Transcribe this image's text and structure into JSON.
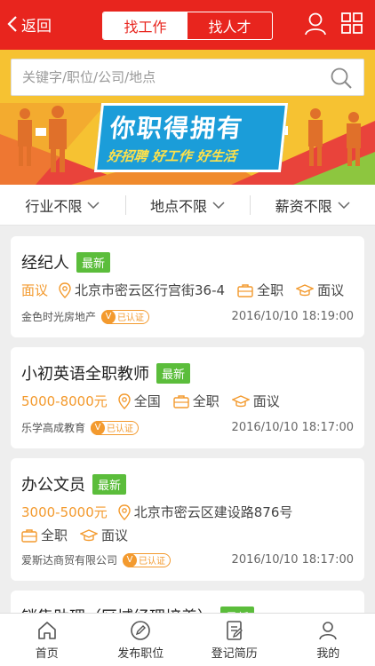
{
  "header": {
    "back_label": "返回",
    "segments": [
      "找工作",
      "找人才"
    ],
    "active_segment": 0,
    "accent": "#e8251e"
  },
  "search": {
    "placeholder": "关键字/职位/公司/地点"
  },
  "banner": {
    "headline": "你职得拥有",
    "subline": "好招聘 好工作 好生活"
  },
  "filters": [
    "行业不限",
    "地点不限",
    "薪资不限"
  ],
  "jobs": [
    {
      "title": "经纪人",
      "badge": "最新",
      "salary": "面议",
      "location": "北京市密云区行宫街36-4",
      "type": "全职",
      "education": "面议",
      "company": "金色时光房地产",
      "verified": "已认证",
      "time": "2016/10/10 18:19:00"
    },
    {
      "title": "小初英语全职教师",
      "badge": "最新",
      "salary": "5000-8000元",
      "location": "全国",
      "type": "全职",
      "education": "面议",
      "company": "乐学高成教育",
      "verified": "已认证",
      "time": "2016/10/10 18:17:00"
    },
    {
      "title": "办公文员",
      "badge": "最新",
      "salary": "3000-5000元",
      "location": "北京市密云区建设路876号",
      "type": "全职",
      "education": "面议",
      "company": "爱斯达商贸有限公司",
      "verified": "已认证",
      "time": "2016/10/10 18:17:00"
    },
    {
      "title": "销售助理（区域经理培养）",
      "badge": "最新"
    }
  ],
  "tabbar": [
    "首页",
    "发布职位",
    "登记简历",
    "我的"
  ],
  "colors": {
    "salary": "#f39a2e",
    "badge": "#5bbd3b",
    "banner_blue": "#1b9dd9"
  }
}
